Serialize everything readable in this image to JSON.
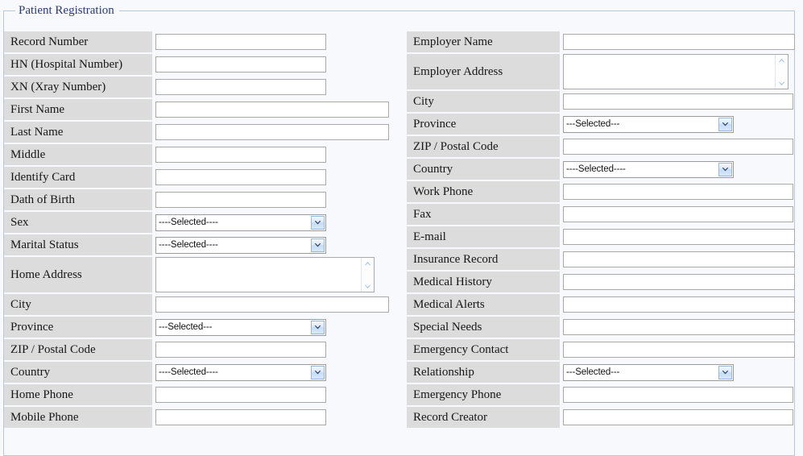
{
  "form": {
    "legend": "Patient Registration",
    "accent_color": "#2a3a72",
    "label_bg": "#dcdcdc",
    "border_color": "#b8c6d9"
  },
  "select_placeholders": {
    "three_dash": "---Selected---",
    "four_dash": "----Selected----"
  },
  "left_column": [
    {
      "label": "Record Number",
      "type": "text",
      "value": "",
      "width": "w-sm"
    },
    {
      "label": "HN (Hospital Number)",
      "type": "text",
      "value": "",
      "width": "w-sm"
    },
    {
      "label": "XN (Xray Number)",
      "type": "text",
      "value": "",
      "width": "w-sm"
    },
    {
      "label": "First Name",
      "type": "text",
      "value": "",
      "width": "w-lg"
    },
    {
      "label": "Last Name",
      "type": "text",
      "value": "",
      "width": "w-lg"
    },
    {
      "label": "Middle",
      "type": "text",
      "value": "",
      "width": "w-sm"
    },
    {
      "label": "Identify Card",
      "type": "text",
      "value": "",
      "width": "w-sm"
    },
    {
      "label": "Dath of Birth",
      "type": "text",
      "value": "",
      "width": "w-sm"
    },
    {
      "label": "Sex",
      "type": "select",
      "value": "----Selected----"
    },
    {
      "label": "Marital Status",
      "type": "select",
      "value": "----Selected----"
    },
    {
      "label": "Home Address",
      "type": "textarea",
      "value": ""
    },
    {
      "label": "City",
      "type": "text",
      "value": "",
      "width": "w-lg"
    },
    {
      "label": "Province",
      "type": "select",
      "value": "---Selected---"
    },
    {
      "label": "ZIP / Postal Code",
      "type": "text",
      "value": "",
      "width": "w-sm"
    },
    {
      "label": "Country",
      "type": "select",
      "value": "----Selected----"
    },
    {
      "label": "Home Phone",
      "type": "text",
      "value": "",
      "width": "w-sm"
    },
    {
      "label": "Mobile Phone",
      "type": "text",
      "value": "",
      "width": "w-sm"
    }
  ],
  "right_column": [
    {
      "label": "Employer Name",
      "type": "text",
      "value": "",
      "width": "w-xl"
    },
    {
      "label": "Employer Address",
      "type": "textarea",
      "value": ""
    },
    {
      "label": "City",
      "type": "text",
      "value": "",
      "width": "w-md"
    },
    {
      "label": "Province",
      "type": "select",
      "value": "---Selected---"
    },
    {
      "label": "ZIP / Postal Code",
      "type": "text",
      "value": "",
      "width": "w-md"
    },
    {
      "label": "Country",
      "type": "select",
      "value": "----Selected----"
    },
    {
      "label": "Work Phone",
      "type": "text",
      "value": "",
      "width": "w-md"
    },
    {
      "label": "Fax",
      "type": "text",
      "value": "",
      "width": "w-md"
    },
    {
      "label": "E-mail",
      "type": "text",
      "value": "",
      "width": "w-xl"
    },
    {
      "label": "Insurance Record",
      "type": "text",
      "value": "",
      "width": "w-xl"
    },
    {
      "label": "Medical History",
      "type": "text",
      "value": "",
      "width": "w-xl"
    },
    {
      "label": "Medical Alerts",
      "type": "text",
      "value": "",
      "width": "w-xl"
    },
    {
      "label": "Special Needs",
      "type": "text",
      "value": "",
      "width": "w-xl"
    },
    {
      "label": "Emergency Contact",
      "type": "text",
      "value": "",
      "width": "w-xl"
    },
    {
      "label": "Relationship",
      "type": "select",
      "value": "---Selected---"
    },
    {
      "label": "Emergency Phone",
      "type": "text",
      "value": "",
      "width": "w-md"
    },
    {
      "label": "Record Creator",
      "type": "text",
      "value": "",
      "width": "w-md"
    }
  ],
  "icons": {
    "chevron_down": "chevron-down-icon",
    "scroll_up": "scroll-up-icon",
    "scroll_down": "scroll-down-icon"
  }
}
